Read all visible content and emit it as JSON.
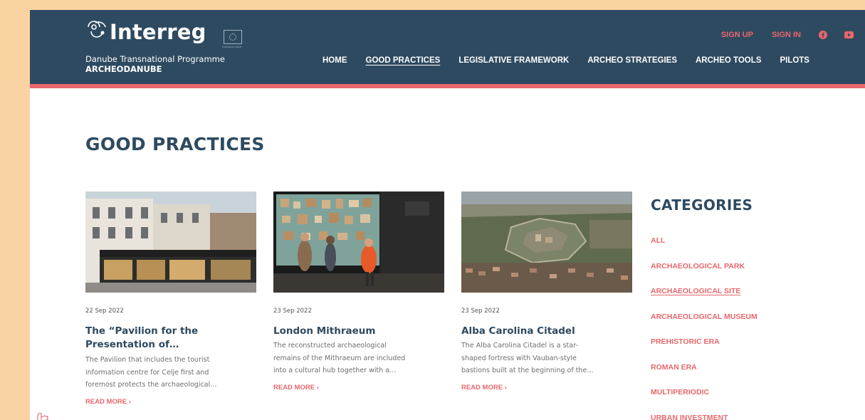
{
  "brand": {
    "name": "Interreg",
    "subtitle": "Danube Transnational Programme",
    "project": "ARCHEODANUBE",
    "eu_caption": "EUROPEAN UNION"
  },
  "top_links": {
    "sign_up": "SIGN UP",
    "sign_in": "SIGN IN"
  },
  "social_icons": [
    "facebook-icon",
    "youtube-icon"
  ],
  "nav": [
    {
      "label": "HOME",
      "active": false
    },
    {
      "label": "GOOD PRACTICES",
      "active": true
    },
    {
      "label": "LEGISLATIVE FRAMEWORK",
      "active": false
    },
    {
      "label": "ARCHEO STRATEGIES",
      "active": false
    },
    {
      "label": "ARCHEO TOOLS",
      "active": false
    },
    {
      "label": "PILOTS",
      "active": false
    }
  ],
  "page_title": "GOOD PRACTICES",
  "cards": [
    {
      "date": "22 Sep 2022",
      "title": "The “Pavilion for the Presentation of…",
      "excerpt": [
        "The Pavilion that includes the tourist",
        "information centre for Celje first and",
        "foremost protects the archaeological…"
      ],
      "read_more": "READ MORE ›"
    },
    {
      "date": "23 Sep 2022",
      "title": "London Mithraeum",
      "excerpt": [
        "The reconstructed archaeological",
        "remains of the Mithraeum are included",
        "into a cultural hub together with a…"
      ],
      "read_more": "READ MORE ›"
    },
    {
      "date": "23 Sep 2022",
      "title": "Alba Carolina Citadel",
      "excerpt": [
        "The Alba Carolina Citadel is a star-",
        "shaped fortress with Vauban-style",
        "bastions built at the beginning of the…"
      ],
      "read_more": "READ MORE ›"
    }
  ],
  "categories": {
    "title": "CATEGORIES",
    "items": [
      {
        "label": "ALL",
        "underlined": false
      },
      {
        "label": "ARCHAEOLOGICAL PARK",
        "underlined": false
      },
      {
        "label": "ARCHAEOLOGICAL SITE",
        "underlined": true
      },
      {
        "label": "ARCHAEOLOGICAL MUSEUM",
        "underlined": false
      },
      {
        "label": "PREHISTORIC ERA",
        "underlined": false
      },
      {
        "label": "ROMAN ERA",
        "underlined": false
      },
      {
        "label": "MULTIPERIODIC",
        "underlined": false
      },
      {
        "label": "URBAN INVESTMENT",
        "underlined": false
      }
    ]
  },
  "colors": {
    "header_bg": "#2e4a60",
    "accent": "#e8676c",
    "outer_bg": "#fbd3a3"
  }
}
